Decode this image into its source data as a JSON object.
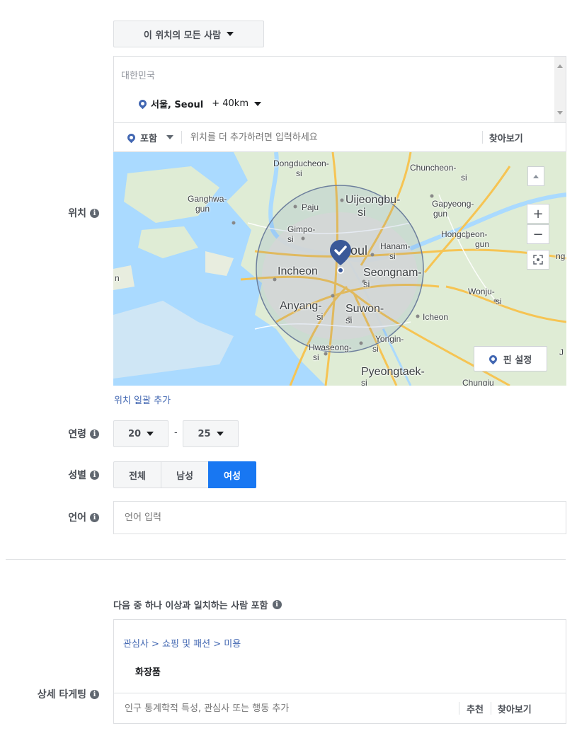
{
  "audience_dropdown": {
    "label": "이 위치의 모든 사람"
  },
  "location": {
    "label": "위치",
    "country": "대한민국",
    "selected_city": "서울, Seoul",
    "radius": "+ 40km",
    "include_label": "포함",
    "search_placeholder": "위치를 더 추가하려면 입력하세요",
    "browse_label": "찾아보기",
    "bulk_add_link": "위치 일괄 추가"
  },
  "map": {
    "labels": {
      "dongducheon": "Dongducheon-",
      "dongducheon_si": "si",
      "chuncheon": "Chuncheon-",
      "chuncheon_si": "si",
      "ganghwa": "Ganghwa-",
      "ganghwa_gun": "gun",
      "paju": "Paju",
      "uijeongbu": "Uijeongbu-",
      "uijeongbu_si": "si",
      "gapyeong": "Gapyeong-",
      "gapyeong_gun": "gun",
      "gimpo": "Gimpo-",
      "gimpo_si": "si",
      "seoul": "oul",
      "hanam": "Hanam-",
      "hanam_si": "si",
      "hongcheon": "Hongcheon-",
      "hongcheon_gun": "gun",
      "incheon": "Incheon",
      "seongnam": "Seongnam-",
      "seongnam_si": "si",
      "wonju": "Wonju-",
      "wonju_si": "si",
      "anyang": "Anyang-",
      "anyang_si": "si",
      "suwon": "Suwon-",
      "suwon_si": "si",
      "icheon": "Icheon",
      "yongin": "Yongin-",
      "yongin_si": "si",
      "hwaseong": "Hwaseong-",
      "hwaseong_si": "si",
      "pyeongtaek": "Pyeongtaek-",
      "pyeongtaek_si": "si",
      "chungju": "Chungju",
      "edge_n": "n",
      "edge_ng": "ng",
      "edge_j": "J"
    },
    "zoom_in": "+",
    "zoom_out": "−",
    "pin_button": "핀 설정"
  },
  "age": {
    "label": "연령",
    "min": "20",
    "dash": "-",
    "max": "25"
  },
  "gender": {
    "label": "성별",
    "options": [
      "전체",
      "남성",
      "여성"
    ],
    "selected": "여성"
  },
  "language": {
    "label": "언어",
    "placeholder": "언어 입력"
  },
  "detailed_targeting": {
    "label": "상세 타게팅",
    "heading": "다음 중 하나 이상과 일치하는 사람 포함",
    "breadcrumb": "관심사 > 쇼핑 및 패션 > 미용",
    "item": "화장품",
    "search_placeholder": "인구 통계학적 특성, 관심사 또는 행동 추가",
    "suggest_label": "추천",
    "browse_label": "찾아보기"
  },
  "colors": {
    "accent": "#4267b2",
    "selected": "#1877f2",
    "map_water": "#aadaff",
    "map_land": "#dfecd5"
  }
}
